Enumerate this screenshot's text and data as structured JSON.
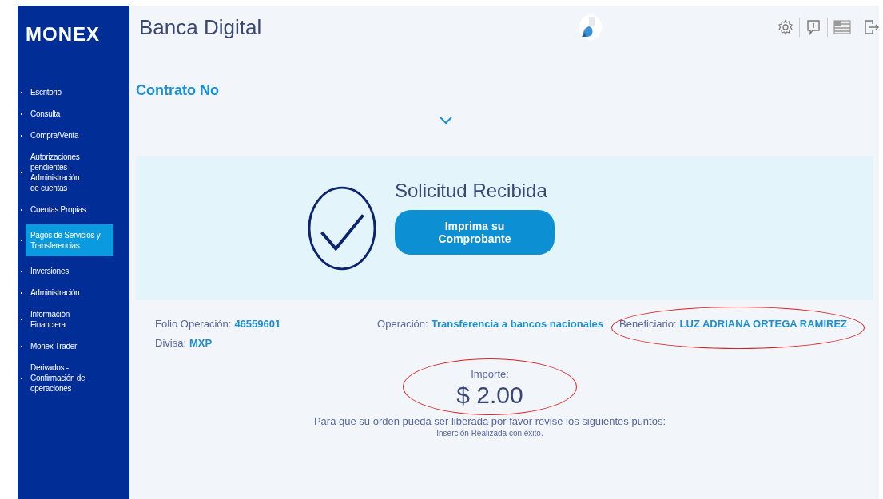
{
  "sidebar": {
    "logo": "MONEX",
    "items": [
      {
        "label": "Escritorio",
        "selected": false
      },
      {
        "label": "Consulta",
        "selected": false
      },
      {
        "label": "Compra/Venta",
        "selected": false
      },
      {
        "label": "Autorizaciones pendientes - Administración de cuentas",
        "selected": false
      },
      {
        "label": "Cuentas Propias",
        "selected": false
      },
      {
        "label": "Pagos de Servicios y Transferencias",
        "selected": true
      },
      {
        "label": "Inversiones",
        "selected": false
      },
      {
        "label": "Administración",
        "selected": false
      },
      {
        "label": "Información Financiera",
        "selected": false
      },
      {
        "label": "Monex Trader",
        "selected": false
      },
      {
        "label": "Derivados - Confirmación de operaciones",
        "selected": false
      }
    ]
  },
  "header": {
    "title": "Banca Digital"
  },
  "contract": {
    "label": "Contrato No"
  },
  "confirmation": {
    "title": "Solicitud Recibida",
    "button": "Imprima su Comprobante"
  },
  "details": {
    "folio": {
      "label": "Folio Operación:",
      "value": "46559601"
    },
    "currency": {
      "label": "Divisa:",
      "value": "MXP"
    },
    "operation": {
      "label": "Operación:",
      "value": "Transferencia a bancos nacionales"
    },
    "beneficiary": {
      "label": "Beneficiario:",
      "value": "LUZ ADRIANA ORTEGA RAMIREZ",
      "highlighted": true
    },
    "amount": {
      "label": "Importe:",
      "value": "$ 2.00",
      "highlighted": true
    },
    "notice": "Para que su orden pueda ser liberada por favor revise los siguientes puntos:",
    "result": "Inserción Realizada con éxito."
  }
}
